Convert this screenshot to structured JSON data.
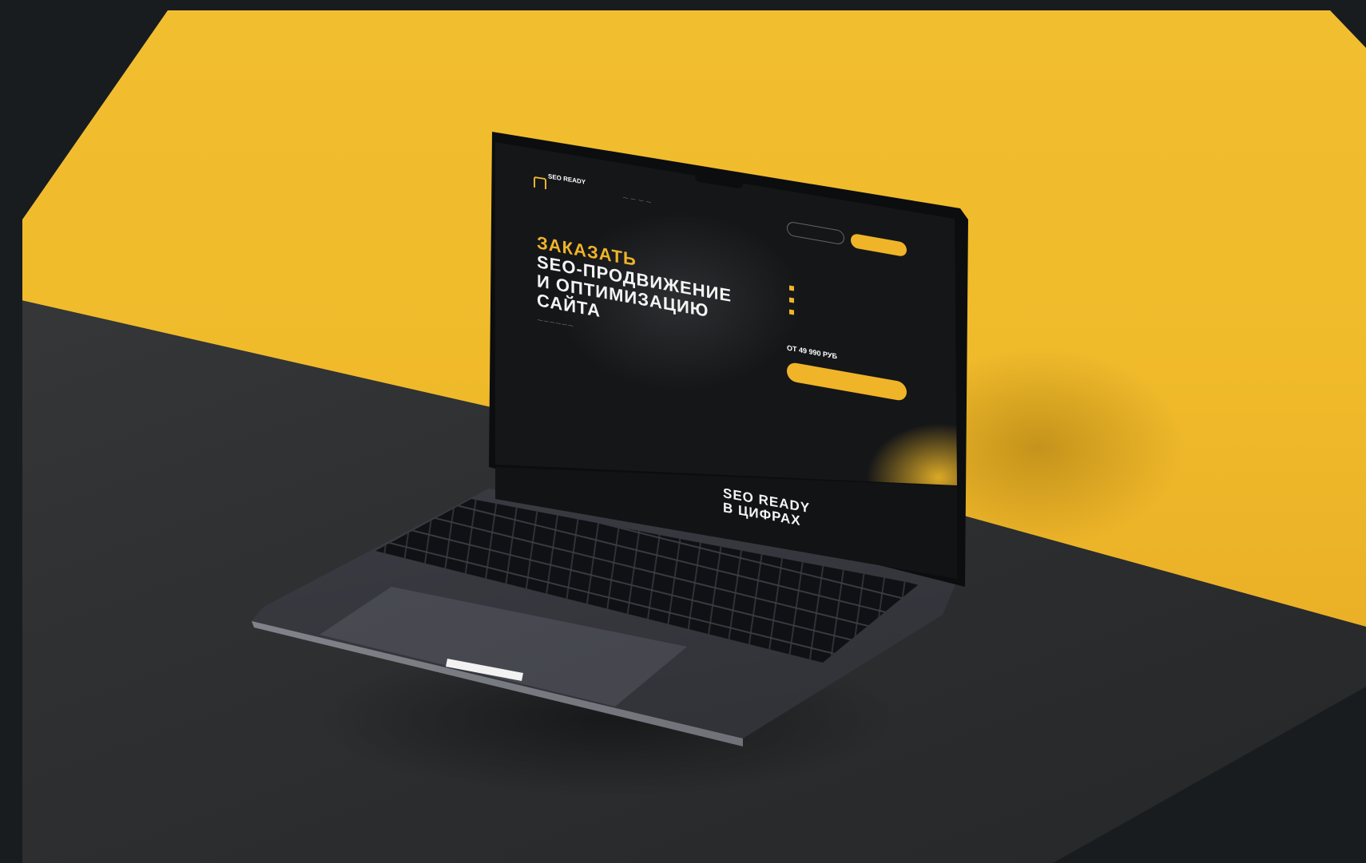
{
  "scene": {
    "colors": {
      "background": "#181c1f",
      "wall": "#f0bb2b",
      "floor": "#2f3133",
      "laptop": "#3a3b42",
      "accent": "#f0b429"
    }
  },
  "screen": {
    "logo_text": "SEO READY",
    "headline": {
      "line1": "ЗАКАЗАТЬ",
      "line2": "SEO-ПРОДВИЖЕНИЕ",
      "line3": "И ОПТИМИЗАЦИЮ",
      "line4": "САЙТА"
    },
    "price": "ОТ 49 990 РУБ",
    "section_title": {
      "line1": "SEO READY",
      "line2": "В ЦИФРАХ"
    }
  }
}
